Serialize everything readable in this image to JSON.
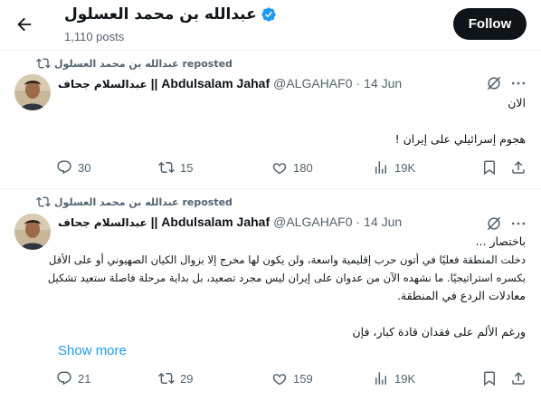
{
  "header": {
    "profile_name": "عبدالله بن محمد العسلول",
    "post_count": "1,110 posts",
    "follow_label": "Follow"
  },
  "tweets": [
    {
      "repost_label": "عبدالله بن محمد العسلول reposted",
      "author_name_ar": "عبدالسلام جحاف",
      "author_name_en": "|| Abdulsalam Jahaf",
      "handle": "@ALGAHAF0",
      "dot": "·",
      "date": "14 Jun",
      "lines": [
        "الان",
        "",
        "هجوم إسرائيلي على إيران !"
      ],
      "stats": {
        "replies": "30",
        "reposts": "15",
        "likes": "180",
        "views": "19K"
      }
    },
    {
      "repost_label": "عبدالله بن محمد العسلول reposted",
      "author_name_ar": "عبدالسلام جحاف",
      "author_name_en": "|| Abdulsalam Jahaf",
      "handle": "@ALGAHAF0",
      "dot": "·",
      "date": "14 Jun",
      "lines": [
        "باختصار ...",
        "دخلت المنطقة فعليًا في أتون حرب إقليمية واسعة، ولن يكون لها مخرج إلا بزوال الكيان الصهيوني أو على الأقل",
        "بكسره استراتيجيًا. ما نشهده الآن من عدوان على إيران ليس مجرد تصعيد، بل بداية مرحلة فاصلة ستعيد تشكيل",
        "معادلات الردع في المنطقة.",
        "",
        "ورغم الألم على فقدان قادة كبار، فإن"
      ],
      "show_more": "Show more",
      "stats": {
        "replies": "21",
        "reposts": "29",
        "likes": "159",
        "views": "19K"
      }
    }
  ]
}
